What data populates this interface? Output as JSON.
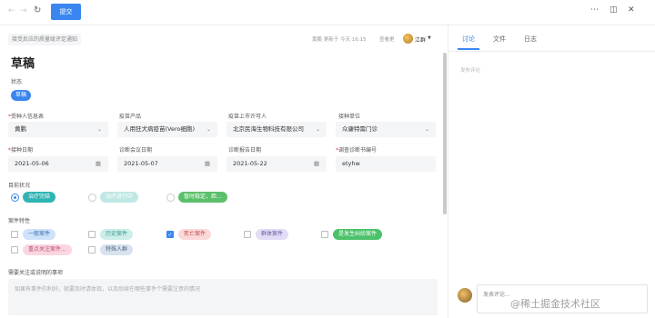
{
  "toolbar": {
    "back_icon": "arrow-left-icon",
    "forward_icon": "arrow-right-icon",
    "refresh_icon": "refresh-icon",
    "submit_label": "提交",
    "more_icon": "more-dots-icon",
    "panel_icon": "panel-toggle-icon",
    "close_icon": "close-icon"
  },
  "header": {
    "notice": "接受反应的质量级评定通知",
    "meta": "黄鹏 更新于 今天 16:15",
    "meta_extra": "查看更",
    "user_name": "江群"
  },
  "form": {
    "title": "草稿",
    "status_label": "状态",
    "status_value": "草稿",
    "fields_row1": [
      {
        "label": "受种人信息表",
        "required": true,
        "value": "黄鹏",
        "icon": "chevron-down-icon"
      },
      {
        "label": "疫苗产品",
        "required": false,
        "value": "人用狂犬病疫苗(Vero细胞)",
        "icon": "chevron-down-icon"
      },
      {
        "label": "疫苗上市许可人",
        "required": false,
        "value": "北京民海生物科技有限公司",
        "icon": "chevron-down-icon"
      },
      {
        "label": "接种单位",
        "required": false,
        "value": "众康特需门诊",
        "icon": "chevron-down-icon"
      }
    ],
    "fields_row2": [
      {
        "label": "接种日期",
        "required": true,
        "value": "2021-05-06",
        "icon": "calendar-icon"
      },
      {
        "label": "诊断会议日期",
        "required": false,
        "value": "2021-05-07",
        "icon": "calendar-icon"
      },
      {
        "label": "诊断报告日期",
        "required": false,
        "value": "2021-05-22",
        "icon": "calendar-icon"
      },
      {
        "label": "调查诊断书编号",
        "required": true,
        "value": "etyhw",
        "icon": ""
      }
    ],
    "current_status_label": "目前状况",
    "current_status_options": [
      {
        "label": "治疗完结",
        "selected": true,
        "color": "#2fb4b4"
      },
      {
        "label": "治疗进行中",
        "selected": false,
        "color": "#bfe8e4"
      },
      {
        "label": "暂时稳定，距...",
        "selected": false,
        "color": "#5cc06a"
      }
    ],
    "case_label": "案件特性",
    "case_options": [
      {
        "label": "一般案件",
        "checked": false,
        "color": "#cfe2fb"
      },
      {
        "label": "历史案件",
        "checked": false,
        "color": "#cdeeea"
      },
      {
        "label": "死亡案件",
        "checked": true,
        "color": "#fbd9d9"
      },
      {
        "label": "群体案件",
        "checked": false,
        "color": "#e3dcf5"
      },
      {
        "label": "是发生纠纷案件",
        "checked": false,
        "color": "#4cc26a"
      },
      {
        "label": "重点关注案件...",
        "checked": false,
        "color": "#fbd6e0"
      },
      {
        "label": "特殊人群",
        "checked": false,
        "color": "#d9e3ef"
      }
    ],
    "notes_label": "需要关注或说明的事项",
    "notes_placeholder": "如果有事件的利好，就要及时请体现，以及后续在哪些事件个需要注意的情况"
  },
  "side": {
    "tabs": [
      "讨论",
      "文件",
      "日志"
    ],
    "active_tab": 0,
    "placeholder": "发布评论",
    "comment_placeholder": "发表评论...",
    "watermark": "@稀土掘金技术社区"
  }
}
